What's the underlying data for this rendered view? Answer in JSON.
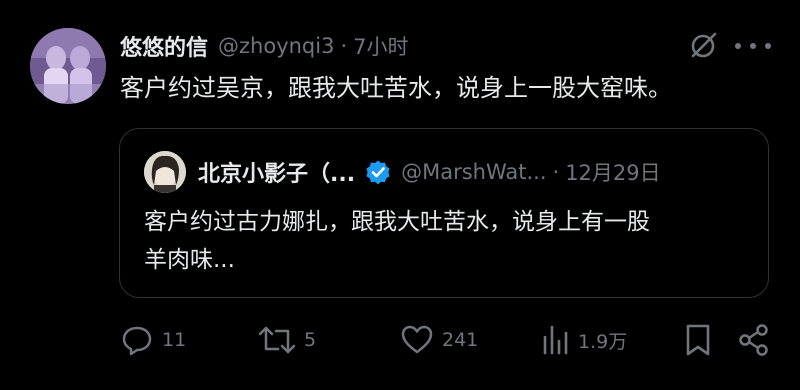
{
  "tweet": {
    "display_name": "悠悠的信",
    "handle": "@zhoynqi3",
    "separator": "·",
    "time": "7小时",
    "text": "客户约过吴京，跟我大吐苦水，说身上一股大窑味。",
    "avatar_icon": "avatar-photo",
    "grok_icon": "grok-icon",
    "more_icon": "more-icon"
  },
  "quote": {
    "display_name": "北京小影子（...",
    "handle": "@MarshWat...",
    "separator": "·",
    "time": "12月29日",
    "text_lines": [
      "客户约过古力娜扎，跟我大吐苦水，说身上有一股",
      "羊肉味..."
    ],
    "verified_color": "#1d9bf0"
  },
  "actions": {
    "reply_count": "11",
    "retweet_count": "5",
    "like_count": "241",
    "views_count": "1.9万"
  },
  "colors": {
    "background": "#000000",
    "text": "#e7e9ea",
    "secondary": "#71767b",
    "border": "#2f3336",
    "accent": "#1d9bf0"
  }
}
